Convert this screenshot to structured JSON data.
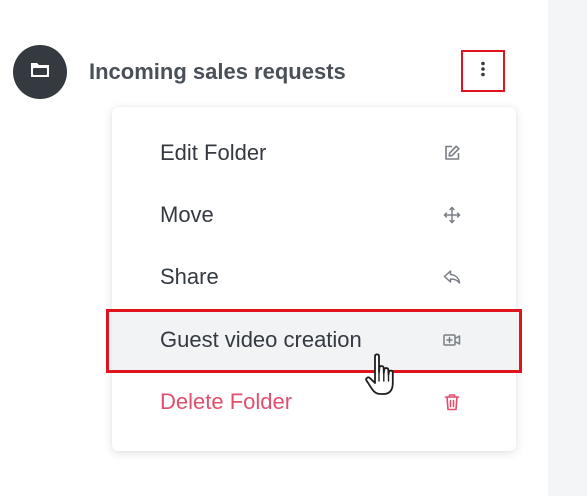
{
  "folder": {
    "title": "Incoming sales requests",
    "icon": "folder-icon"
  },
  "kebab": {
    "icon": "kebab-menu-icon"
  },
  "menu": {
    "items": [
      {
        "label": "Edit Folder",
        "icon": "edit-icon"
      },
      {
        "label": "Move",
        "icon": "move-icon"
      },
      {
        "label": "Share",
        "icon": "share-icon"
      },
      {
        "label": "Guest video creation",
        "icon": "video-add-icon"
      },
      {
        "label": "Delete Folder",
        "icon": "trash-icon"
      }
    ]
  },
  "colors": {
    "highlight": "#e0141e",
    "danger": "#e0506e",
    "avatar": "#343a40"
  }
}
